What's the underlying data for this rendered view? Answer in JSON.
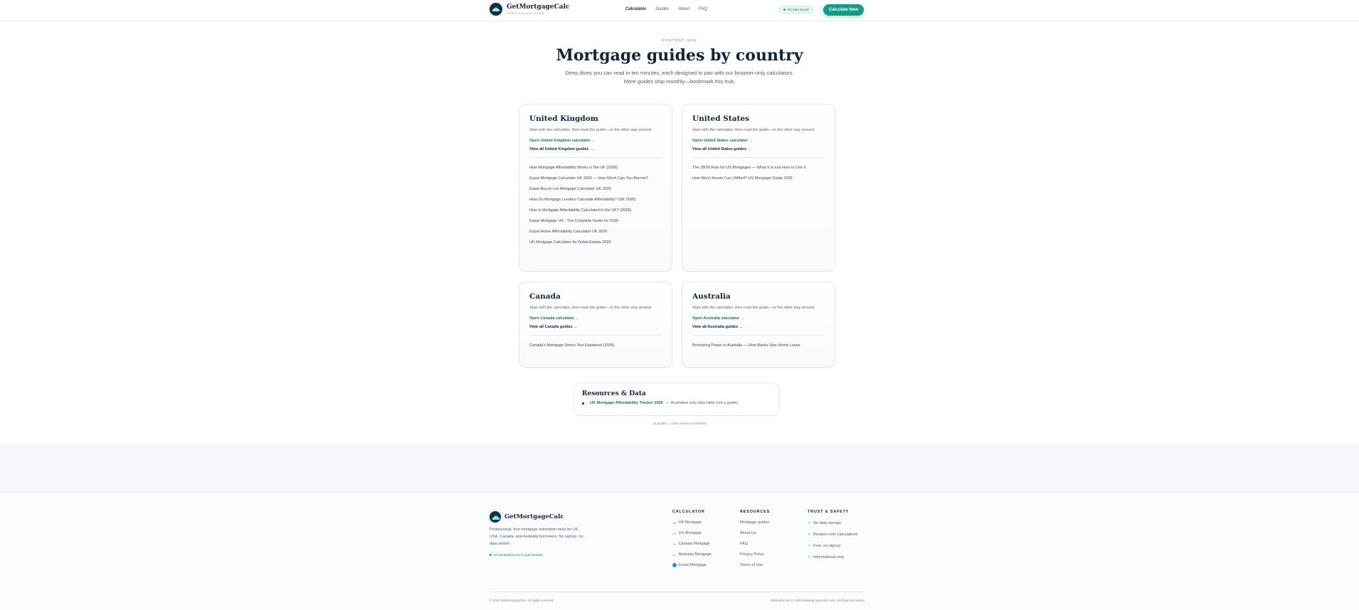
{
  "header": {
    "brand": "GetMortgageCalc",
    "brand_sub": "FREE CALCULATOR",
    "nav": [
      "Calculator",
      "Guides",
      "About",
      "FAQ"
    ],
    "badge": "No data stored",
    "cta": "Calculate Now"
  },
  "hero": {
    "kicker": "CONTENT HUB",
    "title": "Mortgage guides by country",
    "lead": "Deep dives you can read in ten minutes, each designed to pair with our browser-only calculators. More guides ship monthly—bookmark this hub."
  },
  "cards": [
    {
      "title": "United Kingdom",
      "intro": "Start with the calculator, then read the guide—or the other way around.",
      "calc_link": "Open United Kingdom calculator →",
      "guides_link": "View all United Kingdom guides →",
      "items": [
        "How Mortgage Affordability Works in the UK (2026)",
        "Expat Mortgage Calculator UK 2026 — How Much Can You Borrow?",
        "Expat Buy-to-Let Mortgage Calculator UK 2026",
        "How Do Mortgage Lenders Calculate Affordability? (UK 2026)",
        "How is Mortgage Affordability Calculated in the UK? (2026)",
        "Expat Mortgage UK - The Complete Guide for 2026",
        "Expat Home Affordability Calculator UK 2026",
        "UK Mortgage Calculator for Dubai Expats 2026"
      ]
    },
    {
      "title": "United States",
      "intro": "Start with the calculator, then read the guide—or the other way around.",
      "calc_link": "Open United States calculator →",
      "guides_link": "View all United States guides →",
      "items": [
        "The 28/36 Rule for US Mortgages — What It Is and How to Use It",
        "How Much House Can I Afford? US Mortgage Guide 2026"
      ]
    },
    {
      "title": "Canada",
      "intro": "Start with the calculator, then read the guide—or the other way around.",
      "calc_link": "Open Canada calculator →",
      "guides_link": "View all Canada guides →",
      "items": [
        "Canada's Mortgage Stress Test Explained (2026)"
      ]
    },
    {
      "title": "Australia",
      "intro": "Start with the calculator, then read the guide—or the other way around.",
      "calc_link": "Open Australia calculator →",
      "guides_link": "View all Australia guides →",
      "items": [
        "Borrowing Power in Australia — How Banks Size Home Loans"
      ]
    }
  ],
  "resources": {
    "title": "Resources & Data",
    "link": "UK Mortgage Affordability Tracker 2026",
    "desc": "— illustrative only data table (not a guide)."
  },
  "stats": "12 guides · 1 data resource published",
  "footer": {
    "brand": "GetMortgageCalc",
    "desc": "Professional, free mortgage estimation tools for UK, USA, Canada, and Australia borrowers. No signup, no data stored.",
    "note": "All calculations run in your browser",
    "calculator": {
      "heading": "CALCULATOR",
      "items": [
        {
          "flag": "GB",
          "label": "UK Mortgage"
        },
        {
          "flag": "US",
          "label": "US Mortgage"
        },
        {
          "flag": "CA",
          "label": "Canada Mortgage"
        },
        {
          "flag": "AU",
          "label": "Australia Mortgage"
        },
        {
          "flag": "globe",
          "label": "Expat Mortgage"
        }
      ]
    },
    "resources": {
      "heading": "RESOURCES",
      "items": [
        "Mortgage guides",
        "About Us",
        "FAQ",
        "Privacy Policy",
        "Terms of Use"
      ]
    },
    "trust": {
      "heading": "TRUST & SAFETY",
      "items": [
        "No data storage",
        "Browser-only calculations",
        "Free, no signup",
        "Informational only"
      ]
    },
    "copyright": "© 2026 GetMortgageCalc. All rights reserved.",
    "disclaimer": "Estimates are for informational purposes only. Not financial advice."
  }
}
